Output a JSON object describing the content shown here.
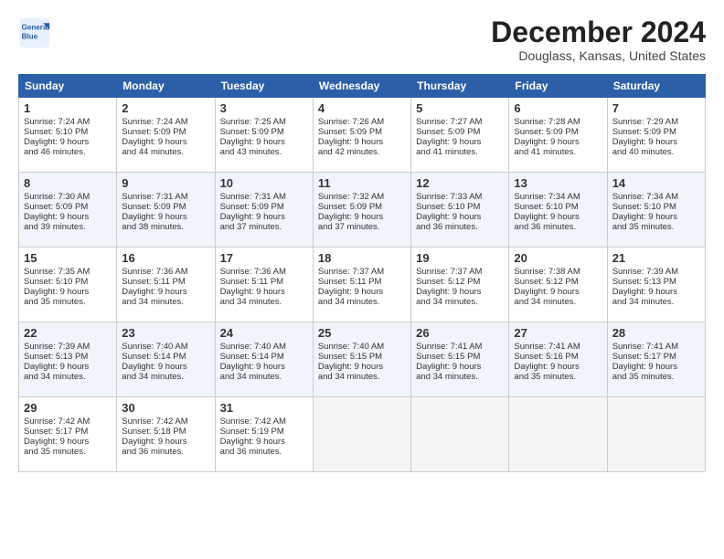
{
  "logo": {
    "line1": "General",
    "line2": "Blue"
  },
  "title": "December 2024",
  "location": "Douglass, Kansas, United States",
  "weekdays": [
    "Sunday",
    "Monday",
    "Tuesday",
    "Wednesday",
    "Thursday",
    "Friday",
    "Saturday"
  ],
  "weeks": [
    [
      {
        "day": "1",
        "lines": [
          "Sunrise: 7:24 AM",
          "Sunset: 5:10 PM",
          "Daylight: 9 hours",
          "and 46 minutes."
        ]
      },
      {
        "day": "2",
        "lines": [
          "Sunrise: 7:24 AM",
          "Sunset: 5:09 PM",
          "Daylight: 9 hours",
          "and 44 minutes."
        ]
      },
      {
        "day": "3",
        "lines": [
          "Sunrise: 7:25 AM",
          "Sunset: 5:09 PM",
          "Daylight: 9 hours",
          "and 43 minutes."
        ]
      },
      {
        "day": "4",
        "lines": [
          "Sunrise: 7:26 AM",
          "Sunset: 5:09 PM",
          "Daylight: 9 hours",
          "and 42 minutes."
        ]
      },
      {
        "day": "5",
        "lines": [
          "Sunrise: 7:27 AM",
          "Sunset: 5:09 PM",
          "Daylight: 9 hours",
          "and 41 minutes."
        ]
      },
      {
        "day": "6",
        "lines": [
          "Sunrise: 7:28 AM",
          "Sunset: 5:09 PM",
          "Daylight: 9 hours",
          "and 41 minutes."
        ]
      },
      {
        "day": "7",
        "lines": [
          "Sunrise: 7:29 AM",
          "Sunset: 5:09 PM",
          "Daylight: 9 hours",
          "and 40 minutes."
        ]
      }
    ],
    [
      {
        "day": "8",
        "lines": [
          "Sunrise: 7:30 AM",
          "Sunset: 5:09 PM",
          "Daylight: 9 hours",
          "and 39 minutes."
        ]
      },
      {
        "day": "9",
        "lines": [
          "Sunrise: 7:31 AM",
          "Sunset: 5:09 PM",
          "Daylight: 9 hours",
          "and 38 minutes."
        ]
      },
      {
        "day": "10",
        "lines": [
          "Sunrise: 7:31 AM",
          "Sunset: 5:09 PM",
          "Daylight: 9 hours",
          "and 37 minutes."
        ]
      },
      {
        "day": "11",
        "lines": [
          "Sunrise: 7:32 AM",
          "Sunset: 5:09 PM",
          "Daylight: 9 hours",
          "and 37 minutes."
        ]
      },
      {
        "day": "12",
        "lines": [
          "Sunrise: 7:33 AM",
          "Sunset: 5:10 PM",
          "Daylight: 9 hours",
          "and 36 minutes."
        ]
      },
      {
        "day": "13",
        "lines": [
          "Sunrise: 7:34 AM",
          "Sunset: 5:10 PM",
          "Daylight: 9 hours",
          "and 36 minutes."
        ]
      },
      {
        "day": "14",
        "lines": [
          "Sunrise: 7:34 AM",
          "Sunset: 5:10 PM",
          "Daylight: 9 hours",
          "and 35 minutes."
        ]
      }
    ],
    [
      {
        "day": "15",
        "lines": [
          "Sunrise: 7:35 AM",
          "Sunset: 5:10 PM",
          "Daylight: 9 hours",
          "and 35 minutes."
        ]
      },
      {
        "day": "16",
        "lines": [
          "Sunrise: 7:36 AM",
          "Sunset: 5:11 PM",
          "Daylight: 9 hours",
          "and 34 minutes."
        ]
      },
      {
        "day": "17",
        "lines": [
          "Sunrise: 7:36 AM",
          "Sunset: 5:11 PM",
          "Daylight: 9 hours",
          "and 34 minutes."
        ]
      },
      {
        "day": "18",
        "lines": [
          "Sunrise: 7:37 AM",
          "Sunset: 5:11 PM",
          "Daylight: 9 hours",
          "and 34 minutes."
        ]
      },
      {
        "day": "19",
        "lines": [
          "Sunrise: 7:37 AM",
          "Sunset: 5:12 PM",
          "Daylight: 9 hours",
          "and 34 minutes."
        ]
      },
      {
        "day": "20",
        "lines": [
          "Sunrise: 7:38 AM",
          "Sunset: 5:12 PM",
          "Daylight: 9 hours",
          "and 34 minutes."
        ]
      },
      {
        "day": "21",
        "lines": [
          "Sunrise: 7:39 AM",
          "Sunset: 5:13 PM",
          "Daylight: 9 hours",
          "and 34 minutes."
        ]
      }
    ],
    [
      {
        "day": "22",
        "lines": [
          "Sunrise: 7:39 AM",
          "Sunset: 5:13 PM",
          "Daylight: 9 hours",
          "and 34 minutes."
        ]
      },
      {
        "day": "23",
        "lines": [
          "Sunrise: 7:40 AM",
          "Sunset: 5:14 PM",
          "Daylight: 9 hours",
          "and 34 minutes."
        ]
      },
      {
        "day": "24",
        "lines": [
          "Sunrise: 7:40 AM",
          "Sunset: 5:14 PM",
          "Daylight: 9 hours",
          "and 34 minutes."
        ]
      },
      {
        "day": "25",
        "lines": [
          "Sunrise: 7:40 AM",
          "Sunset: 5:15 PM",
          "Daylight: 9 hours",
          "and 34 minutes."
        ]
      },
      {
        "day": "26",
        "lines": [
          "Sunrise: 7:41 AM",
          "Sunset: 5:15 PM",
          "Daylight: 9 hours",
          "and 34 minutes."
        ]
      },
      {
        "day": "27",
        "lines": [
          "Sunrise: 7:41 AM",
          "Sunset: 5:16 PM",
          "Daylight: 9 hours",
          "and 35 minutes."
        ]
      },
      {
        "day": "28",
        "lines": [
          "Sunrise: 7:41 AM",
          "Sunset: 5:17 PM",
          "Daylight: 9 hours",
          "and 35 minutes."
        ]
      }
    ],
    [
      {
        "day": "29",
        "lines": [
          "Sunrise: 7:42 AM",
          "Sunset: 5:17 PM",
          "Daylight: 9 hours",
          "and 35 minutes."
        ]
      },
      {
        "day": "30",
        "lines": [
          "Sunrise: 7:42 AM",
          "Sunset: 5:18 PM",
          "Daylight: 9 hours",
          "and 36 minutes."
        ]
      },
      {
        "day": "31",
        "lines": [
          "Sunrise: 7:42 AM",
          "Sunset: 5:19 PM",
          "Daylight: 9 hours",
          "and 36 minutes."
        ]
      },
      null,
      null,
      null,
      null
    ]
  ]
}
